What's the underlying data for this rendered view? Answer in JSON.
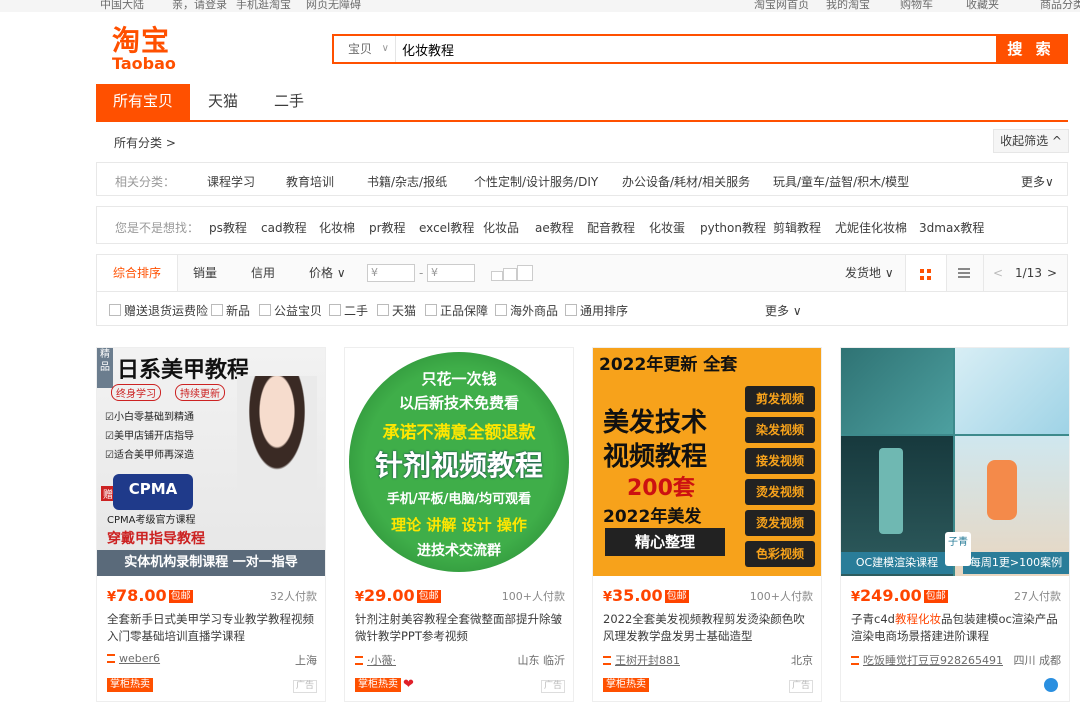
{
  "topbar": {
    "items": [
      "中国大陆",
      "亲，请登录",
      "手机逛淘宝",
      "网页无障碍",
      "淘宝网首页",
      "我的淘宝",
      "购物车",
      "收藏夹",
      "商品分类"
    ]
  },
  "logo": {
    "cn": "淘宝",
    "en": "Taobao"
  },
  "search": {
    "scope": "宝贝",
    "query": "化妆教程",
    "button": "搜 索"
  },
  "tabs": [
    "所有宝贝",
    "天猫",
    "二手"
  ],
  "crumb": "所有分类 >",
  "collapse": "收起筛选 ^",
  "related": {
    "label": "相关分类：",
    "items": [
      "课程学习",
      "教育培训",
      "书籍/杂志/报纸",
      "个性定制/设计服务/DIY",
      "办公设备/耗材/相关服务",
      "玩具/童车/益智/积木/模型"
    ],
    "more": "更多"
  },
  "suggest": {
    "label": "您是不是想找：",
    "items": [
      "ps教程",
      "cad教程",
      "化妆棉",
      "pr教程",
      "excel教程",
      "化妆品",
      "ae教程",
      "配音教程",
      "化妆蛋",
      "python教程",
      "剪辑教程",
      "尤妮佳化妆棉",
      "3dmax教程"
    ]
  },
  "sort": {
    "items": [
      "综合排序",
      "销量",
      "信用",
      "价格"
    ],
    "price_from": "¥",
    "price_to": "¥",
    "ship_from": "发货地",
    "page": "1/13"
  },
  "filters": {
    "items": [
      "赠送退货运费险",
      "新品",
      "公益宝贝",
      "二手",
      "天猫",
      "正品保障",
      "海外商品",
      "通用排序"
    ],
    "more": "更多"
  },
  "products": [
    {
      "price_int": "78.00",
      "bao": "包邮",
      "sales": "32人付款",
      "title": "全套新手日式美甲学习专业教学教程视频入门零基础培训直播学课程",
      "shop": "weber6",
      "loc": "上海",
      "badge": "掌柜热卖",
      "ad": "广告",
      "img": {
        "tag": "精品",
        "head": "日系美甲教程",
        "pill1": "终身学习",
        "pill2": "持续更新",
        "l1": "☑小白零基础到精通",
        "l2": "☑美甲店铺开店指导",
        "l3": "☑适合美甲师再深造",
        "zeng": "赠",
        "cert": "CPMA",
        "cert_sub": "CPMA考级官方课程",
        "b1": "穿戴甲指导教程",
        "b2": "实体机构录制课程  一对一指导"
      }
    },
    {
      "price_int": "29.00",
      "bao": "包邮",
      "sales": "100+人付款",
      "title": "针剂注射美容教程全套微整面部提升除皱微针教学PPT参考视频",
      "shop": "·小薇·",
      "loc": "山东 临沂",
      "badge": "掌柜热卖",
      "ad": "广告",
      "img": {
        "l1": "只花一次钱",
        "l2": "以后新技术免费看",
        "l3": "承诺不满意全额退款",
        "l4": "针剂视频教程",
        "l5": "手机/平板/电脑/均可观看",
        "l6": "理论 讲解 设计 操作",
        "l7": "进技术交流群"
      }
    },
    {
      "price_int": "35.00",
      "bao": "包邮",
      "sales": "100+人付款",
      "title": "2022全套美发视频教程剪发烫染颜色吹风理发教学盘发男士基础造型",
      "shop": "王树开封881",
      "loc": "北京",
      "badge": "掌柜热卖",
      "ad": "广告",
      "img": {
        "top": "2022年更新  全套",
        "big1": "美发技术",
        "big2": "视频教程",
        "num": "200套",
        "year": "2022年美发",
        "dark": "精心整理",
        "tags": [
          "剪发视频",
          "染发视频",
          "接发视频",
          "烫发视频",
          "烫发视频",
          "色彩视频"
        ]
      }
    },
    {
      "price_int": "249.00",
      "bao": "包邮",
      "sales": "27人付款",
      "title_pre": "子青c4d",
      "title_em": "教程化妆",
      "title_post": "品包装建模oc渲染产品渲染电商场景搭建进阶课程",
      "shop": "吃饭睡觉打豆豆928265491",
      "loc": "四川 成都",
      "ad": "广告",
      "img": {
        "left": "OC建模渲染课程",
        "right": "每周1更>100案例",
        "seal": "子青"
      }
    }
  ],
  "colors": {
    "accent": "#ff5000",
    "price": "#ff4400"
  }
}
